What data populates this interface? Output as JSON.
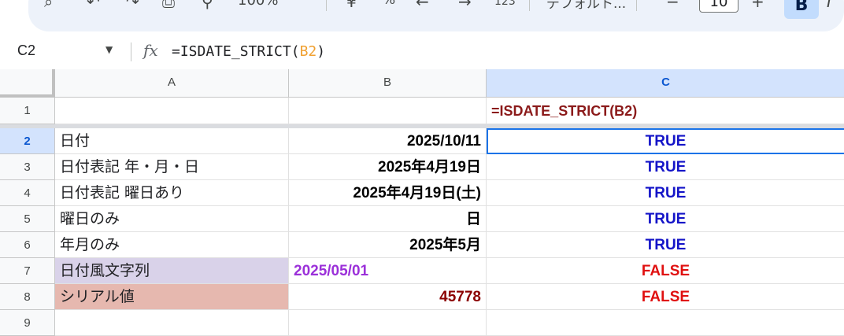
{
  "toolbar": {
    "zoom": "100%",
    "currency": "¥",
    "percent": "%",
    "number_format": "123",
    "font": "デフォルト...",
    "font_size": "10",
    "bold": "B"
  },
  "formula_bar": {
    "name_box": "C2",
    "fx": "fx",
    "formula_prefix": "=ISDATE_STRICT(",
    "formula_ref": "B2",
    "formula_suffix": ")"
  },
  "columns": [
    "A",
    "B",
    "C"
  ],
  "rows": [
    "1",
    "2",
    "3",
    "4",
    "5",
    "6",
    "7",
    "8",
    "9"
  ],
  "cells": {
    "c1": "=ISDATE_STRICT(B2)",
    "r2": {
      "a": "日付",
      "b": "2025/10/11",
      "c": "TRUE"
    },
    "r3": {
      "a": "日付表記 年・月・日",
      "b": "2025年4月19日",
      "c": "TRUE"
    },
    "r4": {
      "a": "日付表記 曜日あり",
      "b": "2025年4月19日(土)",
      "c": "TRUE"
    },
    "r5": {
      "a": "曜日のみ",
      "b": "日",
      "c": "TRUE"
    },
    "r6": {
      "a": "年月のみ",
      "b": "2025年5月",
      "c": "TRUE"
    },
    "r7": {
      "a": "日付風文字列",
      "b": "2025/05/01",
      "c": "FALSE"
    },
    "r8": {
      "a": "シリアル値",
      "b": "45778",
      "c": "FALSE"
    }
  },
  "colors": {
    "true_text": "#1414c8",
    "false_text": "#e01010",
    "header_formula": "#8b1a1a",
    "string_date": "#9b30d9",
    "serial": "#8b0000",
    "row7_fill": "#d9d2e9",
    "row8_fill": "#e6b8af",
    "selection": "#1a73e8"
  }
}
